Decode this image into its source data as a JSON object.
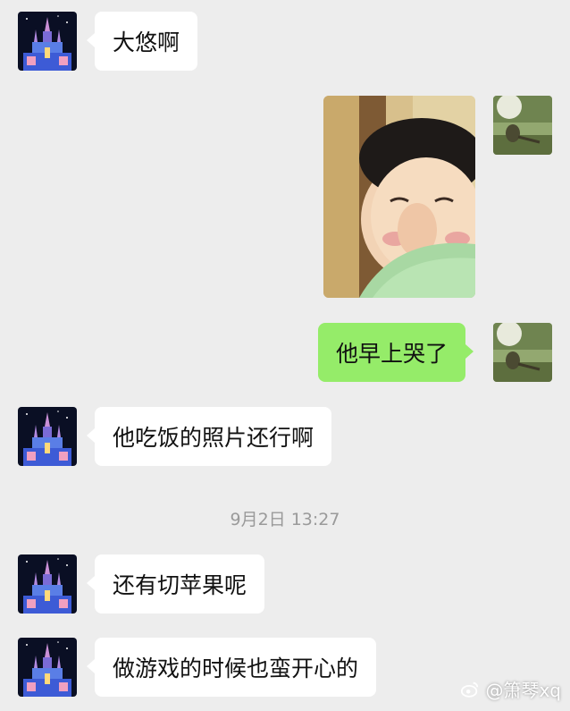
{
  "messages": {
    "m1": {
      "text": "大悠啊"
    },
    "m3": {
      "text": "他早上哭了"
    },
    "m4": {
      "text": "他吃饭的照片还行啊"
    },
    "m5": {
      "text": "还有切苹果呢"
    },
    "m6": {
      "text": "做游戏的时候也蛮开心的"
    }
  },
  "timestamp": "9月2日 13:27",
  "watermark": {
    "text": "@箫琴xq"
  },
  "colors": {
    "background": "#ededed",
    "incoming_bubble": "#ffffff",
    "outgoing_bubble": "#95ec69",
    "timestamp_text": "#9a9a9a"
  }
}
